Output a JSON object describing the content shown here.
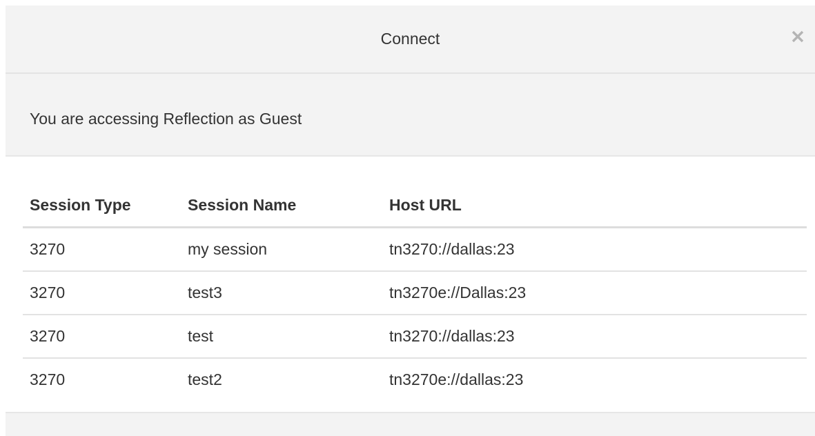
{
  "dialog": {
    "title": "Connect",
    "close_icon": "close-icon"
  },
  "info": {
    "message": "You are accessing Reflection as Guest"
  },
  "table": {
    "headers": [
      "Session Type",
      "Session Name",
      "Host URL"
    ],
    "rows": [
      {
        "type": "3270",
        "name": "my session",
        "host": "tn3270://dallas:23"
      },
      {
        "type": "3270",
        "name": "test3",
        "host": "tn3270e://Dallas:23"
      },
      {
        "type": "3270",
        "name": "test",
        "host": "tn3270://dallas:23"
      },
      {
        "type": "3270",
        "name": "test2",
        "host": "tn3270e://dallas:23"
      }
    ]
  },
  "colors": {
    "header_bg": "#f3f3f3",
    "text": "#333333",
    "close_icon": "#b4b4b4",
    "divider": "#dddddd"
  }
}
